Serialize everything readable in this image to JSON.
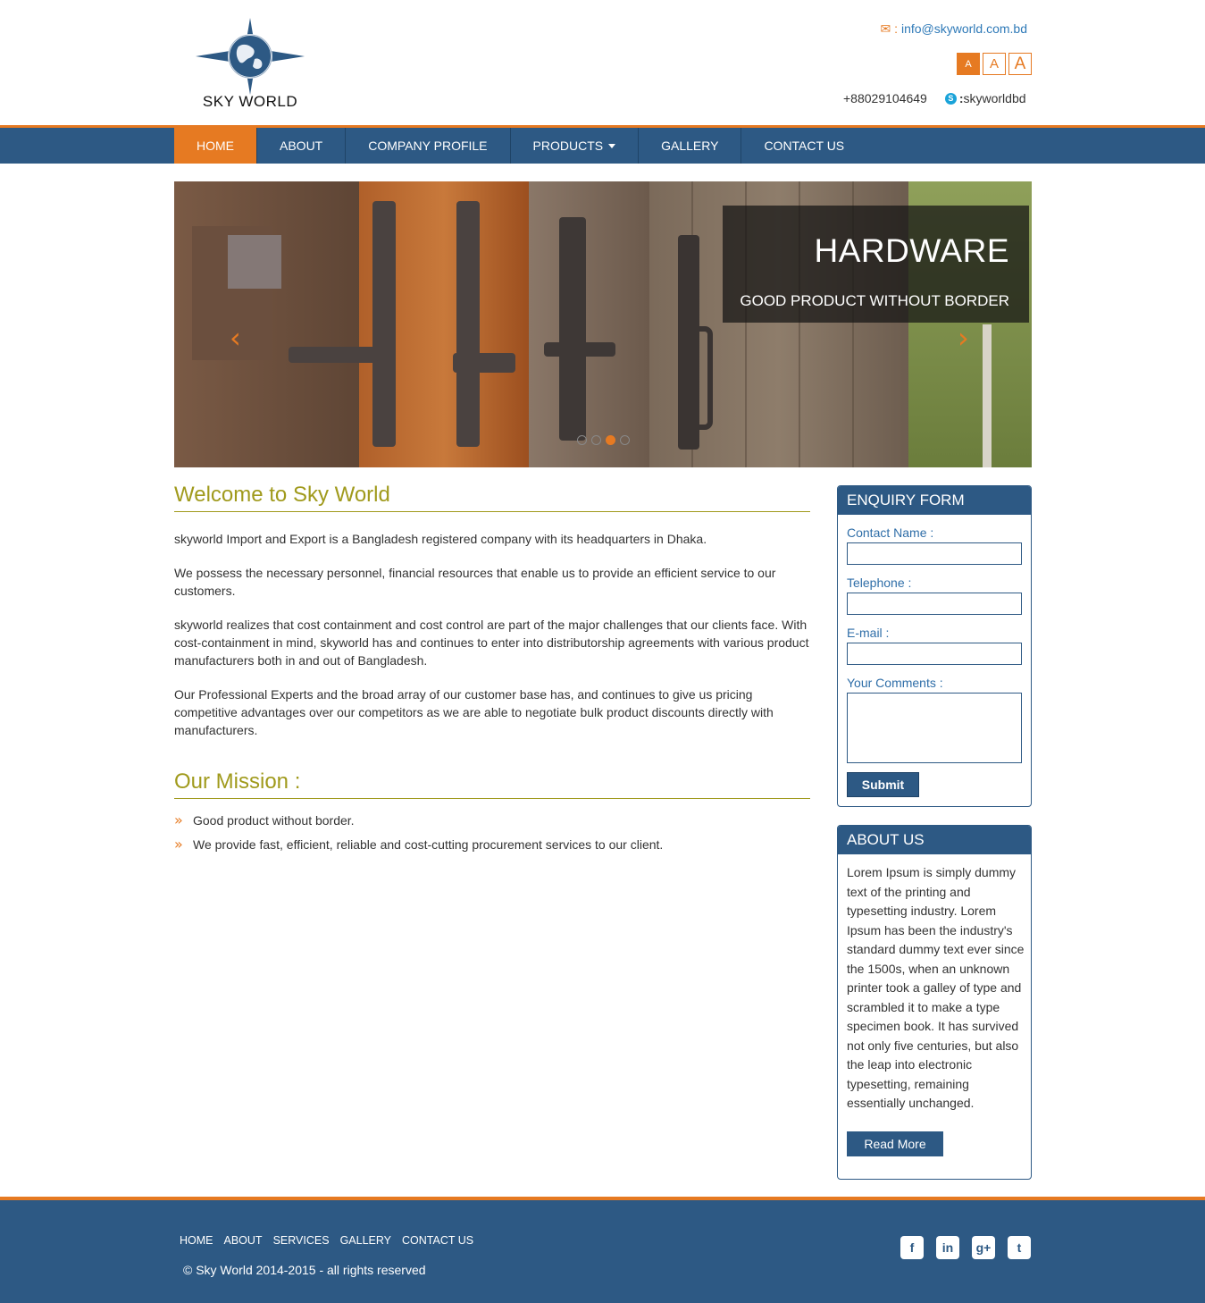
{
  "header": {
    "logo_text": "SKY WORLD",
    "email_prefix": " : ",
    "email": "info@skyworld.com.bd",
    "font_sizes": [
      "A",
      "A",
      "A"
    ],
    "phone": "+88029104649",
    "skype_sep": " : ",
    "skype_user": "skyworldbd"
  },
  "nav": {
    "items": [
      {
        "label": "HOME"
      },
      {
        "label": "ABOUT"
      },
      {
        "label": "COMPANY PROFILE"
      },
      {
        "label": "PRODUCTS"
      },
      {
        "label": "GALLERY"
      },
      {
        "label": "CONTACT US"
      }
    ]
  },
  "slider": {
    "title": "HARDWARE",
    "subtitle": "GOOD PRODUCT WITHOUT BORDER",
    "prev": "‹",
    "next": "›",
    "active_dot": 3
  },
  "welcome": {
    "title": "Welcome to Sky World",
    "paragraphs": [
      "skyworld Import and Export is a Bangladesh registered company with its headquarters in Dhaka.",
      "We possess the necessary personnel, financial resources that enable us to provide an efficient service to our customers.",
      "skyworld realizes that cost containment and cost control are part of the major challenges that our clients face. With cost-containment in mind, skyworld has and continues to enter into distributorship agreements with various product manufacturers both in and out of Bangladesh.",
      "Our Professional Experts and the broad array of our customer base has, and continues to give us pricing competitive advantages over our competitors as we are able to negotiate bulk product discounts directly with manufacturers."
    ]
  },
  "mission": {
    "title": "Our Mission :",
    "items": [
      "Good product without border.",
      "We provide fast, efficient, reliable and cost-cutting procurement services to our client."
    ]
  },
  "enquiry": {
    "title": "ENQUIRY FORM",
    "contact_name_label": "Contact Name :",
    "telephone_label": "Telephone :",
    "email_label": "E-mail :",
    "comments_label": "Your Comments :",
    "submit_label": "Submit"
  },
  "about": {
    "title": "ABOUT US",
    "text": "Lorem Ipsum is simply dummy text of the printing and typesetting industry. Lorem Ipsum has been the industry's standard dummy text ever since the 1500s, when an unknown printer took a galley of type and scrambled it to make a type specimen book. It has survived not only five centuries, but also the leap into electronic typesetting, remaining essentially unchanged.",
    "read_more_label": "Read More"
  },
  "footer": {
    "nav": [
      "HOME",
      "ABOUT",
      "SERVICES",
      "GALLERY",
      "CONTACT US"
    ],
    "copyright": "© Sky World 2014-2015 - all rights reserved",
    "social": [
      {
        "icon": "facebook-icon",
        "glyph": "f"
      },
      {
        "icon": "linkedin-icon",
        "glyph": "in"
      },
      {
        "icon": "google-plus-icon",
        "glyph": "g+"
      },
      {
        "icon": "twitter-icon",
        "glyph": "t"
      }
    ]
  },
  "colors": {
    "brand_blue": "#2d5984",
    "accent_orange": "#e67a22",
    "heading_olive": "#a09a1c",
    "link_blue": "#2f7ab8"
  }
}
